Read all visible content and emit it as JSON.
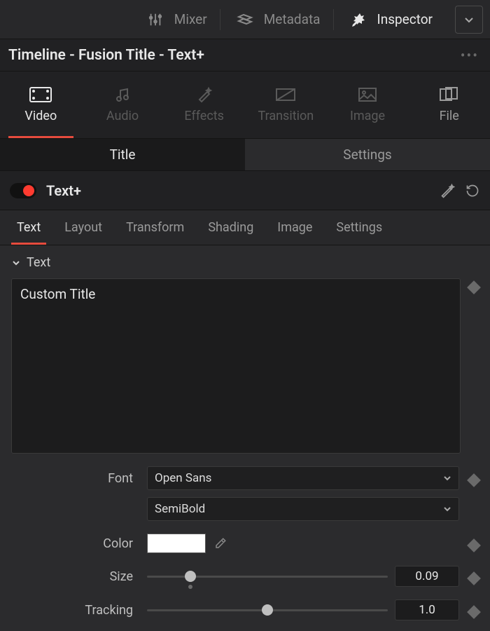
{
  "toolbar": {
    "mixer": "Mixer",
    "metadata": "Metadata",
    "inspector": "Inspector"
  },
  "breadcrumb": "Timeline - Fusion Title - Text+",
  "insp_tabs": {
    "video": "Video",
    "audio": "Audio",
    "effects": "Effects",
    "transition": "Transition",
    "image": "Image",
    "file": "File"
  },
  "segmented": {
    "title": "Title",
    "settings": "Settings"
  },
  "effect": {
    "name": "Text+",
    "enabled": true
  },
  "sub_tabs": {
    "text": "Text",
    "layout": "Layout",
    "transform": "Transform",
    "shading": "Shading",
    "image": "Image",
    "settings": "Settings"
  },
  "section": {
    "label": "Text"
  },
  "text_value": "Custom Title",
  "props": {
    "font_label": "Font",
    "font_family": "Open Sans",
    "font_weight": "SemiBold",
    "color_label": "Color",
    "color_value": "#ffffff",
    "size_label": "Size",
    "size_value": "0.09",
    "size_pos_pct": 18,
    "tracking_label": "Tracking",
    "tracking_value": "1.0",
    "tracking_pos_pct": 50
  }
}
